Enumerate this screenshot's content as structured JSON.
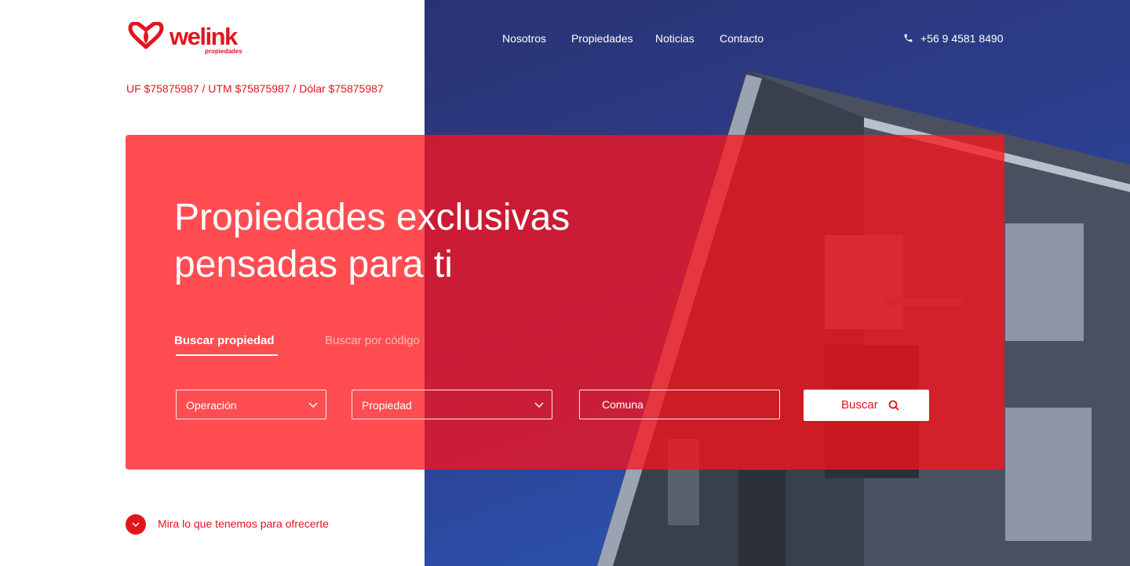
{
  "brand": {
    "name": "welink",
    "tagline": "propiedades",
    "color": "#e2141d"
  },
  "nav": {
    "items": [
      "Nosotros",
      "Propiedades",
      "Noticias",
      "Contacto"
    ]
  },
  "contact": {
    "phone": "+56 9 4581 8490",
    "icon": "phone-icon"
  },
  "rates": "UF $75875987 / UTM $75875987 / Dólar $75875987",
  "hero": {
    "title_line1": "Propiedades exclusivas",
    "title_line2": "pensadas para ti",
    "background": "building-photo"
  },
  "search": {
    "tabs": [
      {
        "label": "Buscar propiedad",
        "active": true
      },
      {
        "label": "Buscar por código",
        "active": false
      }
    ],
    "operacion": "Operación",
    "propiedad": "Propiedad",
    "comuna_placeholder": "Comuna",
    "button_label": "Buscar",
    "overlay_color": "#ff1218"
  },
  "scroll_hint": "Mira lo que tenemos para ofrecerte"
}
